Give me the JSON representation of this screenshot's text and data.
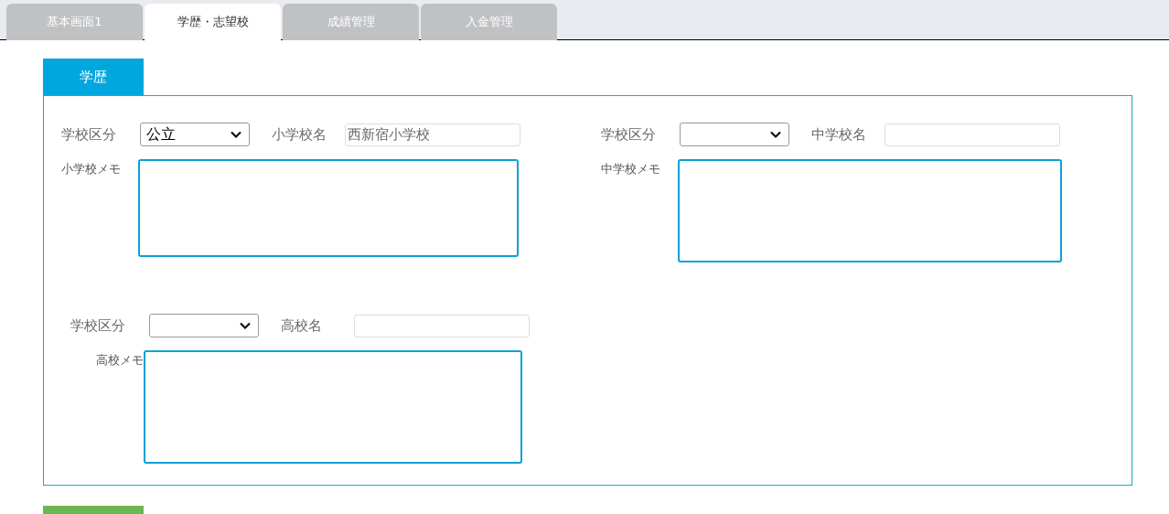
{
  "tabs": [
    {
      "label": "基本画面1",
      "selected": false
    },
    {
      "label": "学歴・志望校",
      "selected": true
    },
    {
      "label": "成績管理",
      "selected": false
    },
    {
      "label": "入金管理",
      "selected": false
    }
  ],
  "section": {
    "title": "学歴",
    "schools": [
      {
        "type_label": "学校区分",
        "type_value": "公立",
        "name_label": "小学校名",
        "name_value": "西新宿小学校",
        "memo_label": "小学校メモ"
      },
      {
        "type_label": "学校区分",
        "name_label": "中学校名",
        "memo_label": "中学校メモ"
      },
      {
        "type_label": "学校区分",
        "name_label": "高校名",
        "memo_label": "高校メモ"
      }
    ]
  }
}
